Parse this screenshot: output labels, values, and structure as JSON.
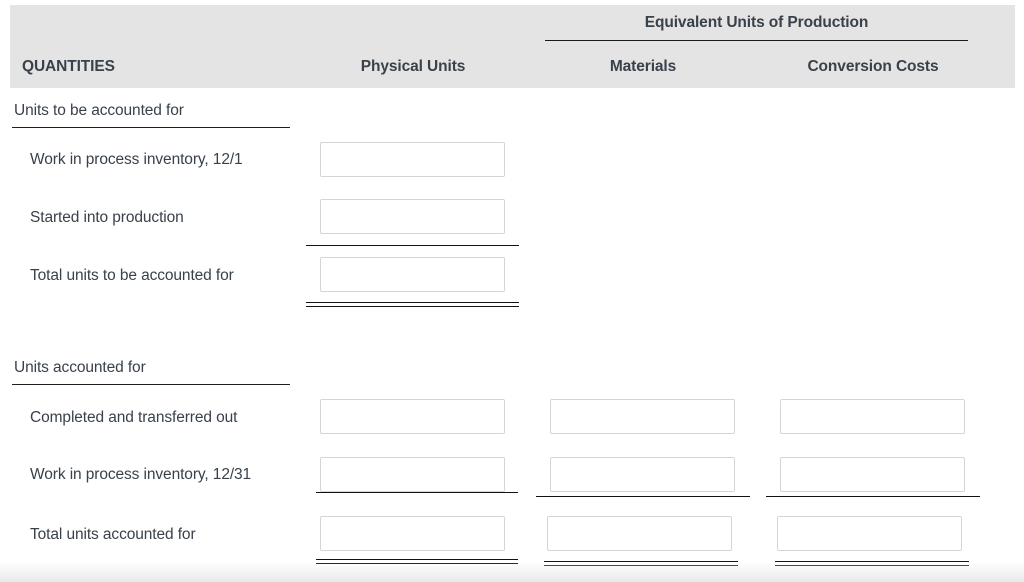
{
  "header": {
    "group_label": "Equivalent Units of Production",
    "columns": {
      "quantities": "QUANTITIES",
      "physical_units": "Physical Units",
      "materials": "Materials",
      "conversion_costs": "Conversion Costs"
    },
    "band_color": "#e4e4e4",
    "text_color": "#39414b"
  },
  "sections": [
    {
      "title": "Units to be accounted for",
      "rows": [
        {
          "label": "Work in process inventory, 12/1",
          "physical_units": "",
          "materials": null,
          "conversion_costs": null,
          "placeholder": ""
        },
        {
          "label": "Started into production",
          "physical_units": "",
          "materials": null,
          "conversion_costs": null,
          "placeholder": ""
        },
        {
          "label": "Total units to be accounted for",
          "physical_units": "",
          "materials": null,
          "conversion_costs": null,
          "placeholder": ""
        }
      ]
    },
    {
      "title": "Units accounted for",
      "rows": [
        {
          "label": "Completed and transferred out",
          "physical_units": "",
          "materials": "",
          "conversion_costs": "",
          "placeholder": ""
        },
        {
          "label": "Work in process inventory, 12/31",
          "physical_units": "",
          "materials": "",
          "conversion_costs": "",
          "placeholder": ""
        },
        {
          "label": "Total units accounted for",
          "physical_units": "",
          "materials": "",
          "conversion_costs": "",
          "placeholder": ""
        }
      ]
    }
  ]
}
